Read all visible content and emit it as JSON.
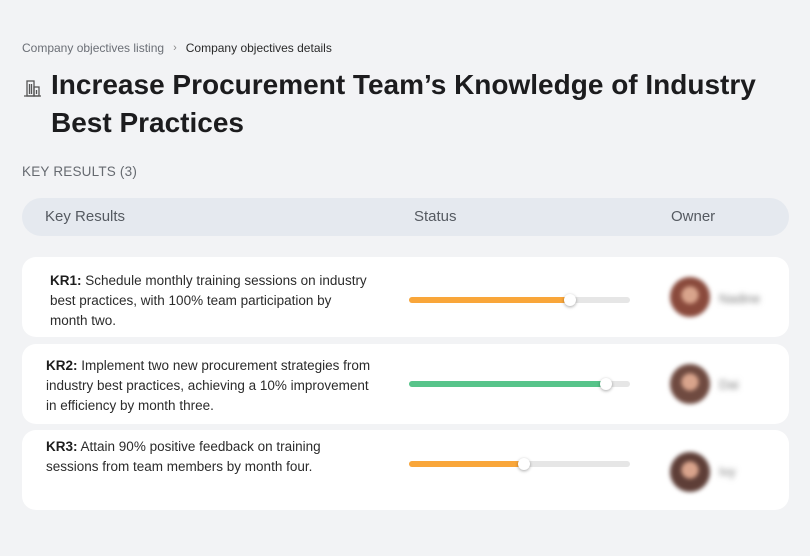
{
  "breadcrumb": {
    "parent": "Company objectives listing",
    "separator": "›",
    "current": "Company objectives details"
  },
  "objective": {
    "icon": "building-icon",
    "title": "Increase Procurement Team’s Knowledge of Industry Best Practices"
  },
  "key_results_section": {
    "label": "KEY RESULTS (3)"
  },
  "table": {
    "headers": {
      "key_results": "Key Results",
      "status": "Status",
      "owner": "Owner"
    },
    "rows": [
      {
        "code": "KR1:",
        "text": "Schedule monthly training sessions on industry best practices, with 100% team participation by month two.",
        "progress": 0.73,
        "progress_color": "#f9a63a",
        "owner_name": "Nadine",
        "avatar_color": "#8a4a3c"
      },
      {
        "code": "KR2:",
        "text": "Implement two new procurement strategies from industry best practices, achieving a 10% improvement in efficiency by month three.",
        "progress": 0.89,
        "progress_color": "#57c48a",
        "owner_name": "Dai",
        "avatar_color": "#6f4a40"
      },
      {
        "code": "KR3:",
        "text": "Attain 90% positive feedback on training sessions from team members by month four.",
        "progress": 0.52,
        "progress_color": "#f9a63a",
        "owner_name": "Ivy",
        "avatar_color": "#5e3e37"
      }
    ]
  }
}
